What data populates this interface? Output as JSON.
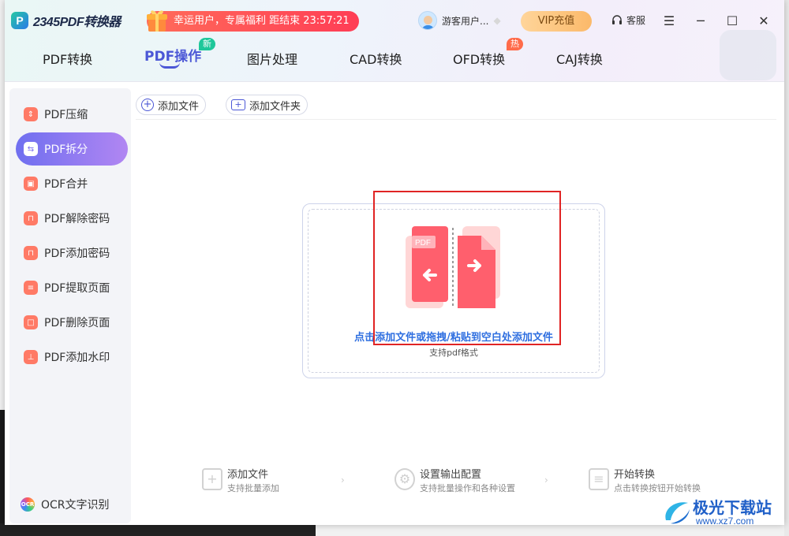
{
  "app": {
    "logo_text": "2345PDF转换器",
    "promo_text": "幸运用户，专属福利 距结束 23:57:21",
    "username": "游客用户...",
    "vip_label": "VIP充值",
    "service_label": "客服"
  },
  "tabs": [
    {
      "label": "PDF转换"
    },
    {
      "label": "PDF操作",
      "badge": "新"
    },
    {
      "label": "图片处理"
    },
    {
      "label": "CAD转换"
    },
    {
      "label": "OFD转换",
      "badge": "热"
    },
    {
      "label": "CAJ转换"
    }
  ],
  "sidebar": {
    "items": [
      {
        "label": "PDF压缩"
      },
      {
        "label": "PDF拆分"
      },
      {
        "label": "PDF合并"
      },
      {
        "label": "PDF解除密码"
      },
      {
        "label": "PDF添加密码"
      },
      {
        "label": "PDF提取页面"
      },
      {
        "label": "PDF删除页面"
      },
      {
        "label": "PDF添加水印"
      }
    ],
    "ocr_label": "OCR文字识别"
  },
  "toolbar": {
    "add_file": "添加文件",
    "add_folder": "添加文件夹"
  },
  "dropzone": {
    "pdf_tag": "PDF",
    "main_text": "点击添加文件或拖拽/粘贴到空白处添加文件",
    "sub_text": "支持pdf格式"
  },
  "steps": [
    {
      "title": "添加文件",
      "desc": "支持批量添加"
    },
    {
      "title": "设置输出配置",
      "desc": "支持批量操作和各种设置"
    },
    {
      "title": "开始转换",
      "desc": "点击转换按钮开始转换"
    }
  ],
  "watermark": {
    "name": "极光下载站",
    "url": "www.xz7.com"
  },
  "colors": {
    "accent": "#4b57d6",
    "promo": "#ff3d55",
    "highlight_box": "#e02424"
  }
}
